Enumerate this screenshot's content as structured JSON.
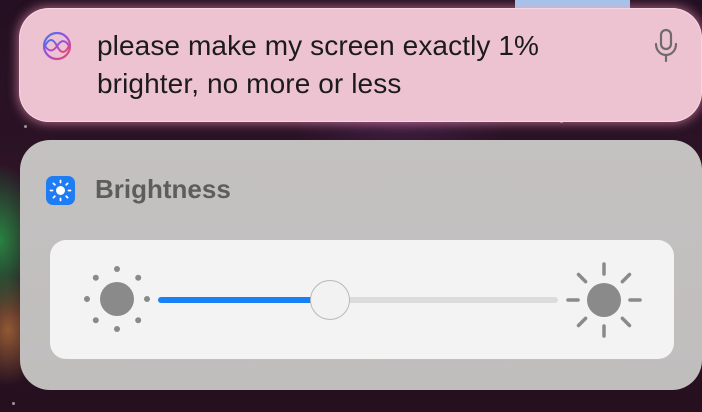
{
  "siri": {
    "request_text": "please make my screen exactly 1% brighter, no more or less",
    "icon": "siri-icon",
    "mic_icon": "microphone-icon",
    "bubble_color": "#eec3d1"
  },
  "brightness": {
    "title": "Brightness",
    "app_icon": "brightness-sun-icon",
    "low_icon": "sun-low-icon",
    "high_icon": "sun-high-icon",
    "level": 0.43,
    "accent_color": "#1a80f5"
  }
}
